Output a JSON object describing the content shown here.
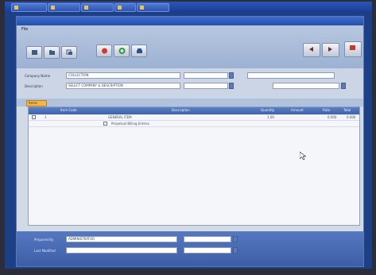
{
  "menu": {
    "text": "File"
  },
  "toolbar": {
    "buttons": [
      {
        "name": "new-icon",
        "color": "#3c5a8a"
      },
      {
        "name": "open-icon",
        "color": "#3c5a8a"
      },
      {
        "name": "copy-icon",
        "color": "#3c5a8a"
      },
      {
        "name": "delete-icon",
        "color": "#d23a2a"
      },
      {
        "name": "refresh-icon",
        "color": "#2f9a3a"
      },
      {
        "name": "print-icon",
        "color": "#2d4f9a"
      },
      {
        "name": "back-icon",
        "color": "#7a2b2b"
      },
      {
        "name": "forward-icon",
        "color": "#7a2b2b"
      },
      {
        "name": "exit-icon",
        "color": "#c43a2a"
      }
    ]
  },
  "form": {
    "label1": "Company Name",
    "label2": "Description",
    "field1": "COLLECTION",
    "field2": "SELECT COMPANY & DESCRIPTION",
    "field3": "",
    "field4": "",
    "field5": "",
    "field6": ""
  },
  "tab": {
    "label": "Items"
  },
  "grid": {
    "headers": [
      "",
      "Item Code",
      "Description",
      "Quantity",
      "Amount",
      "Rate",
      "Total"
    ],
    "rows": [
      {
        "code": "1",
        "desc": "GENERAL ITEM",
        "qty": "1.00",
        "amount": "",
        "rate": "0.000",
        "total": "0.000"
      },
      {
        "code": "",
        "desc": "Perpetual Billing Entries",
        "qty": "",
        "amount": "",
        "rate": "",
        "total": ""
      }
    ]
  },
  "footer": {
    "label1": "Prepared By",
    "label2": "Last Modified",
    "field1": "ADMINISTRATOR",
    "field2": "",
    "field3": "",
    "field4": ""
  }
}
